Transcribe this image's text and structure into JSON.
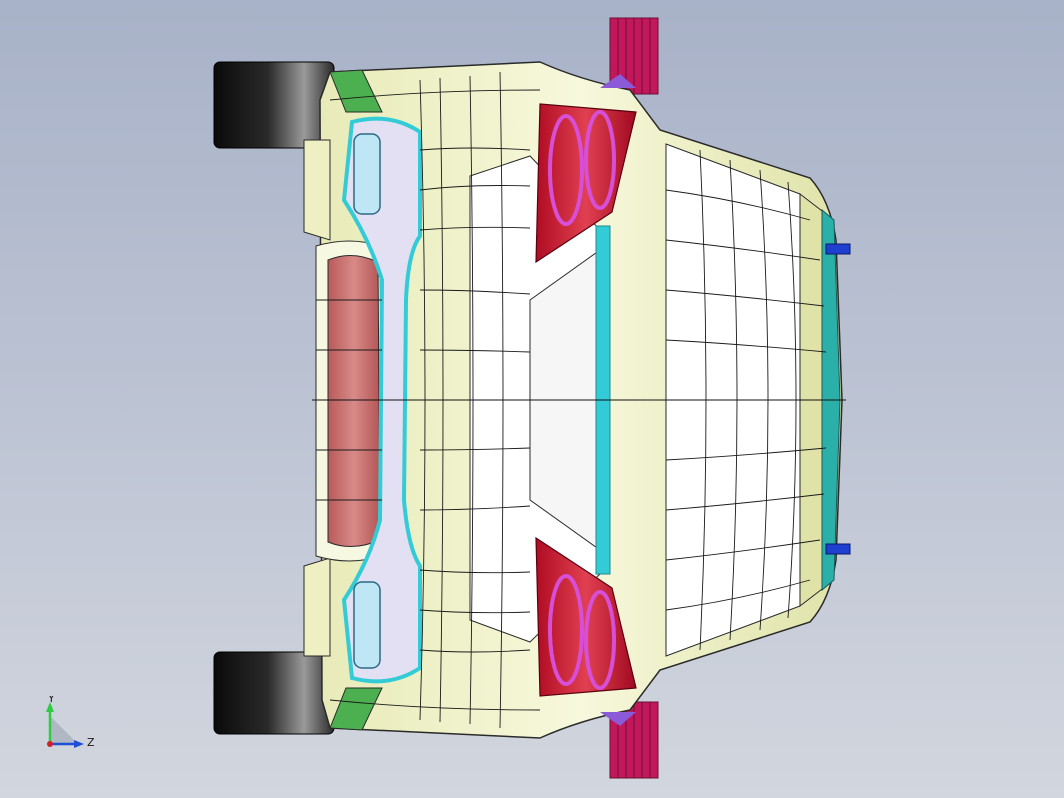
{
  "viewport": {
    "background_top": "#a8b2c8",
    "background_bottom": "#d2d6de"
  },
  "model": {
    "body_color": "#f4f6cf",
    "window_color": "#ffffff",
    "taillight_color": "#c8102e",
    "taillight_ring_color": "#d64fd6",
    "headlight_color": "#bfe6f5",
    "trim_color": "#33ccd6",
    "tire_color": "#111111",
    "mudflap_color": "#c2185b",
    "bumper_color": "#c96a6a",
    "green_trim_color": "#4caf50"
  },
  "triad": {
    "y_label": "Y",
    "z_label": "Z",
    "y_color": "#2ecc40",
    "z_color": "#1e4fd8",
    "x_color": "#d0202a"
  }
}
